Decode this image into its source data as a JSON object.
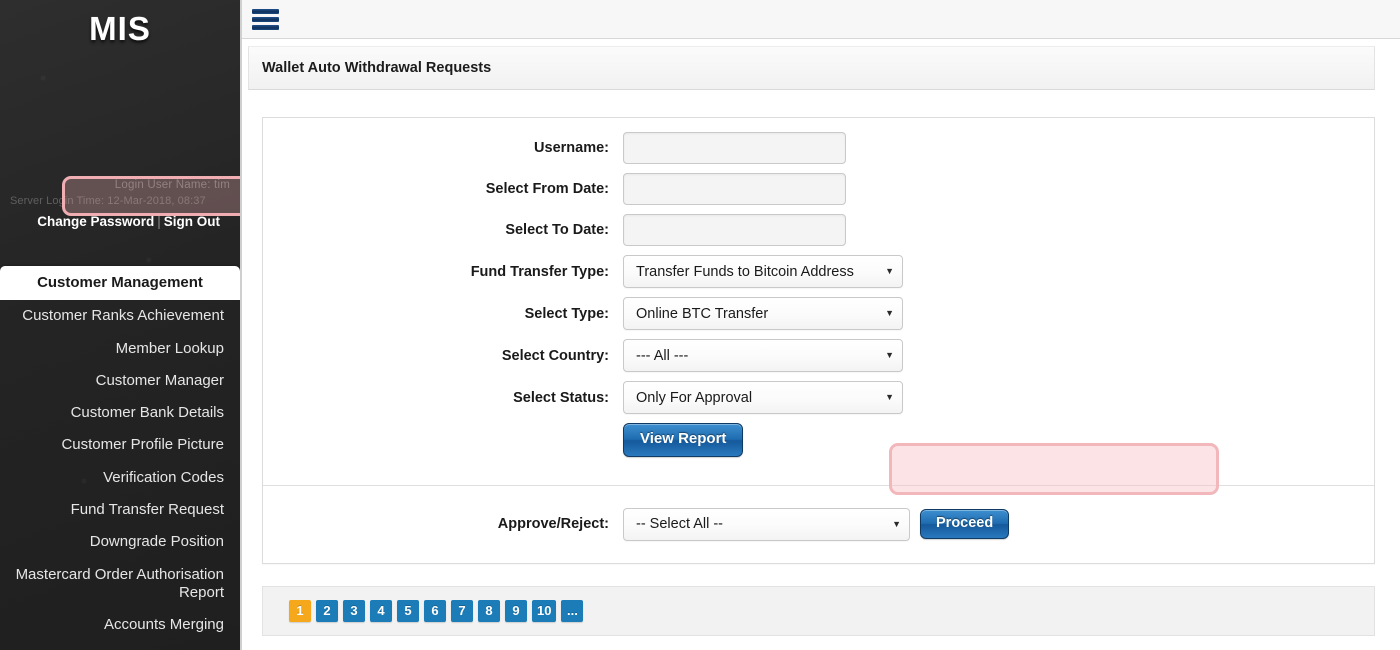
{
  "sidebar": {
    "brand": "MIS",
    "login_user": "Login User Name: tim",
    "server_time": "Server Login Time: 12-Mar-2018, 08:37",
    "change_password": "Change Password",
    "separator": "|",
    "sign_out": "Sign Out",
    "items": [
      {
        "label": "Customer Management",
        "active": true
      },
      {
        "label": "Customer Ranks Achievement",
        "active": false
      },
      {
        "label": "Member Lookup",
        "active": false
      },
      {
        "label": "Customer Manager",
        "active": false
      },
      {
        "label": "Customer Bank Details",
        "active": false
      },
      {
        "label": "Customer Profile Picture",
        "active": false
      },
      {
        "label": "Verification Codes",
        "active": false
      },
      {
        "label": "Fund Transfer Request",
        "active": false
      },
      {
        "label": "Downgrade Position",
        "active": false
      },
      {
        "label": "Mastercard Order Authorisation Report",
        "active": false
      },
      {
        "label": "Accounts Merging",
        "active": false
      }
    ]
  },
  "topbar": {
    "menu_icon": "hamburger-menu-icon"
  },
  "page": {
    "title": "Wallet Auto Withdrawal Requests"
  },
  "form": {
    "username": {
      "label": "Username:",
      "value": "",
      "placeholder": ""
    },
    "from_date": {
      "label": "Select From Date:",
      "value": "",
      "placeholder": ""
    },
    "to_date": {
      "label": "Select To Date:",
      "value": "",
      "placeholder": ""
    },
    "fund_transfer_type": {
      "label": "Fund Transfer Type:",
      "value": "Transfer Funds to Bitcoin Address"
    },
    "select_type": {
      "label": "Select Type:",
      "value": "Online BTC Transfer"
    },
    "select_country": {
      "label": "Select Country:",
      "value": "--- All ---"
    },
    "select_status": {
      "label": "Select Status:",
      "value": "Only For Approval"
    },
    "view_report_button": "View Report"
  },
  "approve": {
    "label": "Approve/Reject:",
    "value": "-- Select All --",
    "proceed_button": "Proceed"
  },
  "pagination": {
    "pages": [
      "1",
      "2",
      "3",
      "4",
      "5",
      "6",
      "7",
      "8",
      "9",
      "10",
      "..."
    ],
    "active": "1"
  },
  "colors": {
    "sidebar_bg": "#262626",
    "button_blue": "#1f6cb0",
    "page_active_orange": "#f5a81c",
    "page_blue": "#1c7cb8",
    "highlight_pink": "#f2b7bb",
    "menu_icon_blue": "#143766"
  }
}
